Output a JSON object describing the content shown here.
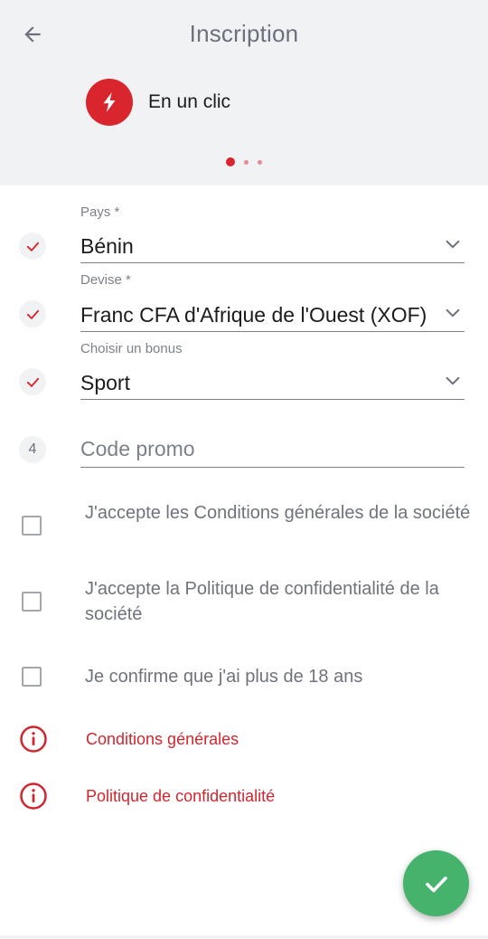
{
  "header": {
    "title": "Inscription",
    "mode_label": "En un clic",
    "page_dots": 3,
    "active_dot": 1
  },
  "form": {
    "country": {
      "label": "Pays *",
      "value": "Bénin",
      "completed": true
    },
    "currency": {
      "label": "Devise *",
      "value": "Franc CFA d'Afrique de l'Ouest (XOF)",
      "completed": true
    },
    "bonus": {
      "label": "Choisir un bonus",
      "value": "Sport",
      "completed": true
    },
    "promo": {
      "step_number": "4",
      "placeholder": "Code promo",
      "value": ""
    }
  },
  "agreements": [
    {
      "text": "J'accepte les Conditions générales de la société",
      "checked": false
    },
    {
      "text": "J'accepte la Politique de confidentialité de la société",
      "checked": false
    },
    {
      "text": "Je confirme que j'ai plus de 18 ans",
      "checked": false
    }
  ],
  "links": [
    {
      "text": "Conditions générales"
    },
    {
      "text": "Politique de confidentialité"
    }
  ],
  "colors": {
    "accent_red": "#d9252d",
    "confirm_green": "#45b36b",
    "header_bg": "#f1f2f4",
    "muted_text": "#6e737c"
  },
  "icons": {
    "back": "arrow-left-icon",
    "mode": "lightning-bolt-icon",
    "completed": "checkmark-icon",
    "dropdown": "chevron-down-icon",
    "info": "info-circle-icon",
    "confirm": "checkmark-icon"
  }
}
